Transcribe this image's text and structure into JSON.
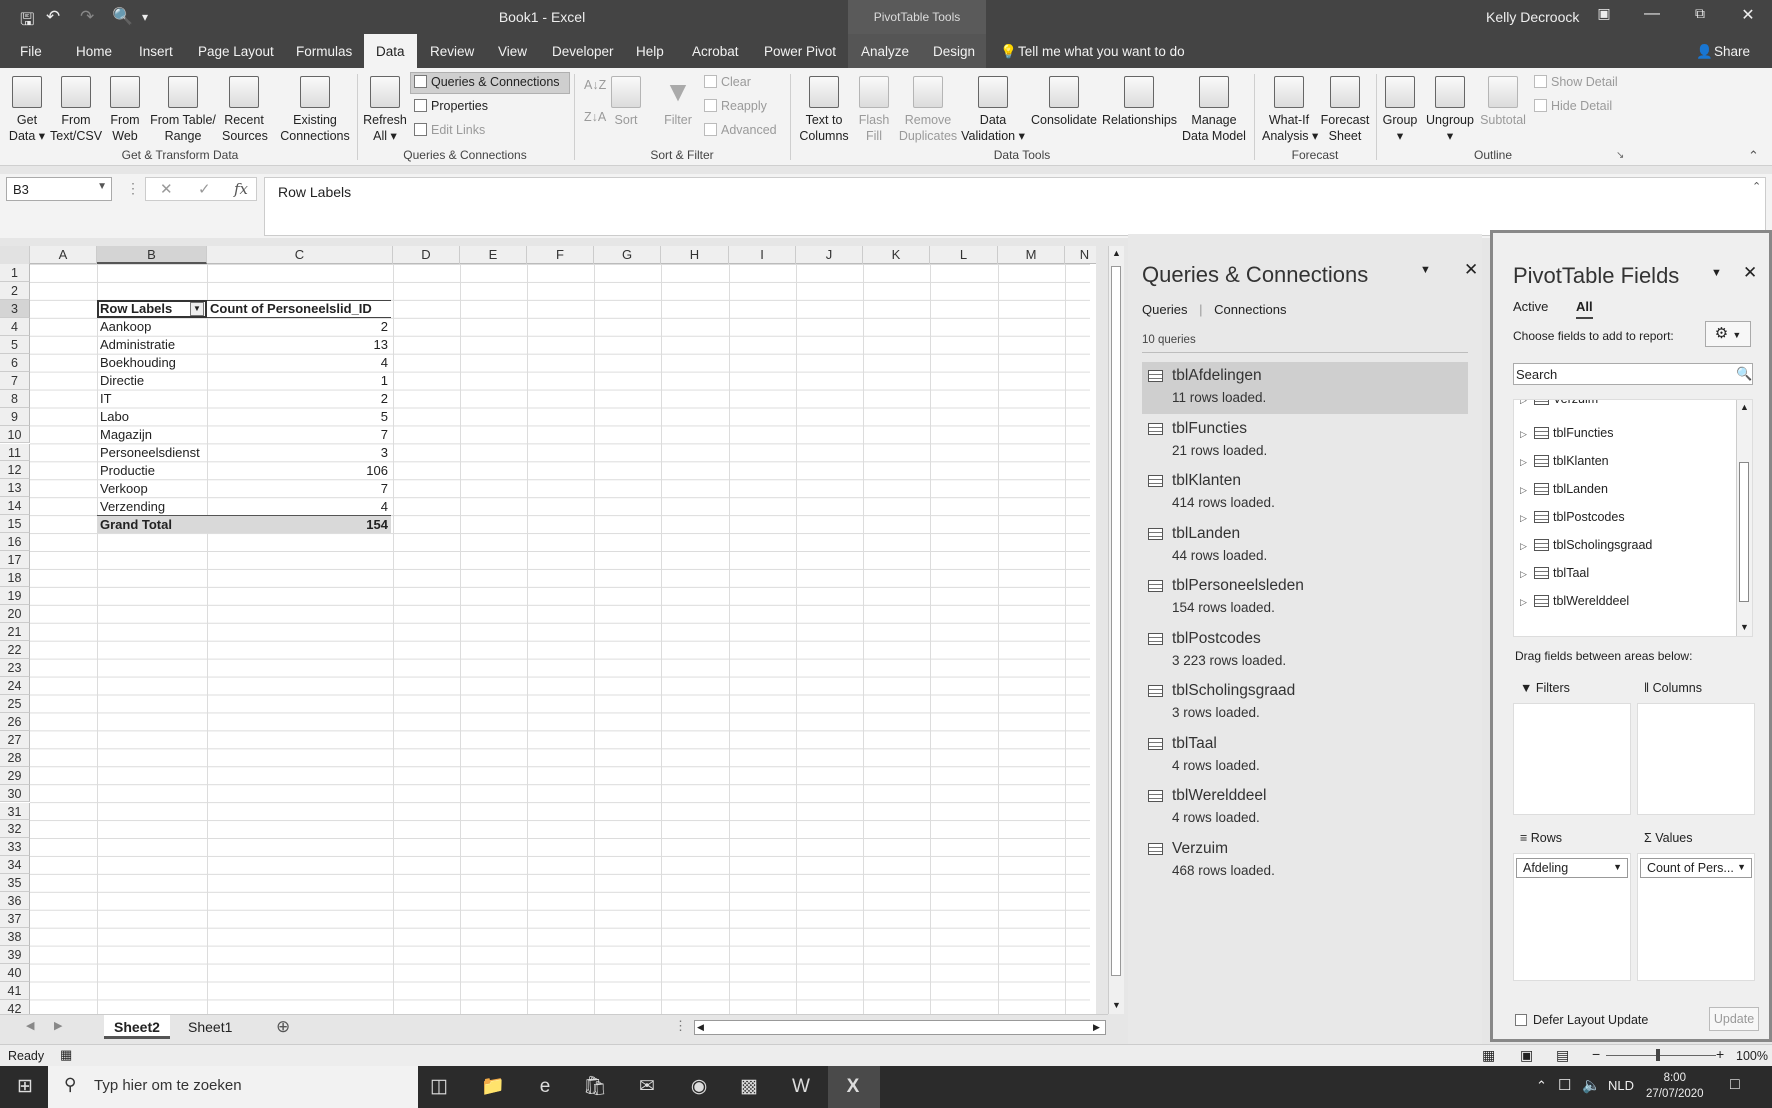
{
  "window": {
    "title": "Book1  -  Excel",
    "context_tools": "PivotTable Tools",
    "user": "Kelly Decroock",
    "qat_icons": [
      "save-icon",
      "undo-icon",
      "redo-icon",
      "print-preview-icon",
      "customize-icon"
    ]
  },
  "tabs": [
    "File",
    "Home",
    "Insert",
    "Page Layout",
    "Formulas",
    "Data",
    "Review",
    "View",
    "Developer",
    "Help",
    "Acrobat",
    "Power Pivot",
    "Analyze",
    "Design"
  ],
  "active_tab": "Data",
  "tell_me": "Tell me what you want to do",
  "share": "Share",
  "ribbon": {
    "get_transform": {
      "label": "Get & Transform Data",
      "get_data": [
        "Get",
        "Data ▾"
      ],
      "from_text": [
        "From",
        "Text/CSV"
      ],
      "from_web": [
        "From",
        "Web"
      ],
      "from_table": [
        "From Table/",
        "Range"
      ],
      "recent": [
        "Recent",
        "Sources"
      ],
      "existing": [
        "Existing",
        "Connections"
      ]
    },
    "queries": {
      "label": "Queries & Connections",
      "refresh": [
        "Refresh",
        "All ▾"
      ],
      "queries_connections": "Queries & Connections",
      "properties": "Properties",
      "edit_links": "Edit Links"
    },
    "sort_filter": {
      "label": "Sort & Filter",
      "sort": "Sort",
      "filter": "Filter",
      "clear": "Clear",
      "reapply": "Reapply",
      "advanced": "Advanced"
    },
    "data_tools": {
      "label": "Data Tools",
      "text_to_columns": [
        "Text to",
        "Columns"
      ],
      "flash_fill": [
        "Flash",
        "Fill"
      ],
      "remove_duplicates": [
        "Remove",
        "Duplicates"
      ],
      "data_validation": [
        "Data",
        "Validation ▾"
      ],
      "consolidate": "Consolidate",
      "relationships": "Relationships",
      "manage_model": [
        "Manage",
        "Data Model"
      ]
    },
    "forecast": {
      "label": "Forecast",
      "what_if": [
        "What-If",
        "Analysis ▾"
      ],
      "forecast_sheet": [
        "Forecast",
        "Sheet"
      ]
    },
    "outline": {
      "label": "Outline",
      "group": [
        "Group",
        "▾"
      ],
      "ungroup": [
        "Ungroup",
        "▾"
      ],
      "subtotal": "Subtotal",
      "show_detail": "Show Detail",
      "hide_detail": "Hide Detail"
    }
  },
  "formula_bar": {
    "name_box": "B3",
    "fx": "fx",
    "content": "Row Labels"
  },
  "grid": {
    "columns": [
      "A",
      "B",
      "C",
      "D",
      "E",
      "F",
      "G",
      "H",
      "I",
      "J",
      "K",
      "L",
      "M",
      "N"
    ],
    "row_numbers": [
      "1",
      "2",
      "3",
      "4",
      "5",
      "6",
      "7",
      "8",
      "9",
      "10",
      "11",
      "12",
      "13",
      "14",
      "15",
      "16",
      "17",
      "18",
      "19",
      "20",
      "21",
      "22",
      "23",
      "24",
      "25",
      "26",
      "27",
      "28",
      "29",
      "30",
      "31",
      "32",
      "33",
      "34",
      "35",
      "36",
      "37",
      "38",
      "39",
      "40",
      "41",
      "42"
    ]
  },
  "pivot": {
    "header_label": "Row Labels",
    "header_value": "Count of Personeelslid_ID",
    "rows": [
      {
        "label": "Aankoop",
        "value": "2"
      },
      {
        "label": "Administratie",
        "value": "13"
      },
      {
        "label": "Boekhouding",
        "value": "4"
      },
      {
        "label": "Directie",
        "value": "1"
      },
      {
        "label": "IT",
        "value": "2"
      },
      {
        "label": "Labo",
        "value": "5"
      },
      {
        "label": "Magazijn",
        "value": "7"
      },
      {
        "label": "Personeelsdienst",
        "value": "3"
      },
      {
        "label": "Productie",
        "value": "106"
      },
      {
        "label": "Verkoop",
        "value": "7"
      },
      {
        "label": "Verzending",
        "value": "4"
      }
    ],
    "total_label": "Grand Total",
    "total_value": "154"
  },
  "sheet_tabs": [
    "Sheet2",
    "Sheet1"
  ],
  "active_sheet": "Sheet2",
  "queries_pane": {
    "title": "Queries & Connections",
    "tab_queries": "Queries",
    "tab_connections": "Connections",
    "count": "10 queries",
    "items": [
      {
        "name": "tblAfdelingen",
        "status": "11 rows loaded."
      },
      {
        "name": "tblFuncties",
        "status": "21 rows loaded."
      },
      {
        "name": "tblKlanten",
        "status": "414 rows loaded."
      },
      {
        "name": "tblLanden",
        "status": "44 rows loaded."
      },
      {
        "name": "tblPersoneelsleden",
        "status": "154 rows loaded."
      },
      {
        "name": "tblPostcodes",
        "status": "3 223 rows loaded."
      },
      {
        "name": "tblScholingsgraad",
        "status": "3 rows loaded."
      },
      {
        "name": "tblTaal",
        "status": "4 rows loaded."
      },
      {
        "name": "tblWerelddeel",
        "status": "4 rows loaded."
      },
      {
        "name": "Verzuim",
        "status": "468 rows loaded."
      }
    ]
  },
  "pivot_pane": {
    "title": "PivotTable Fields",
    "tab_active": "Active",
    "tab_all": "All",
    "choose": "Choose fields to add to report:",
    "search_placeholder": "Search",
    "fields": [
      "Verzuim",
      "tblFuncties",
      "tblKlanten",
      "tblLanden",
      "tblPostcodes",
      "tblScholingsgraad",
      "tblTaal",
      "tblWerelddeel"
    ],
    "drag_text": "Drag fields between areas below:",
    "areas": {
      "filters": "Filters",
      "columns": "Columns",
      "rows": "Rows",
      "values": "Values",
      "rows_field": "Afdeling",
      "values_field": "Count of Pers..."
    },
    "defer": "Defer Layout Update",
    "update": "Update"
  },
  "status": {
    "ready": "Ready",
    "zoom": "100%"
  },
  "taskbar": {
    "search": "Typ hier om te zoeken",
    "lang": "NLD",
    "time": "8:00",
    "date": "27/07/2020"
  }
}
